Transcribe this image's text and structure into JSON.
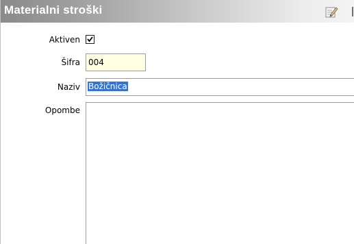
{
  "panel": {
    "title": "Materialni stroški",
    "edit_icon": "pencil-edit-icon"
  },
  "form": {
    "aktiven": {
      "label": "Aktiven",
      "checked": true
    },
    "sifra": {
      "label": "Šifra",
      "value": "004"
    },
    "naziv": {
      "label": "Naziv",
      "value": "Božičnica"
    },
    "opombe": {
      "label": "Opombe",
      "value": ""
    }
  },
  "colors": {
    "title_text": "#ffffff",
    "sifra_background": "#ffffe1",
    "selection": "#3373d6"
  }
}
